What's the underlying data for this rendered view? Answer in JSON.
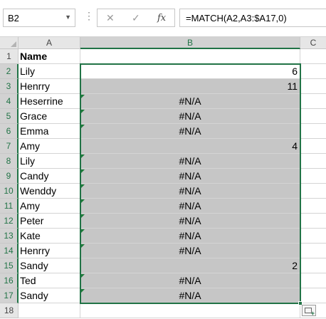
{
  "formula_bar": {
    "name_box": "B2",
    "cancel_symbol": "✕",
    "enter_symbol": "✓",
    "fx_label": "fx",
    "formula": "=MATCH(A2,A3:$A17,0)"
  },
  "columns": {
    "a": "A",
    "b": "B",
    "c": "C"
  },
  "rows": [
    {
      "num": "1",
      "a": "Name",
      "b": ""
    },
    {
      "num": "2",
      "a": "Lily",
      "b": "6"
    },
    {
      "num": "3",
      "a": "Henrry",
      "b": "11"
    },
    {
      "num": "4",
      "a": "Heserrine",
      "b": "#N/A"
    },
    {
      "num": "5",
      "a": "Grace",
      "b": "#N/A"
    },
    {
      "num": "6",
      "a": "Emma",
      "b": "#N/A"
    },
    {
      "num": "7",
      "a": "Amy",
      "b": "4"
    },
    {
      "num": "8",
      "a": "Lily",
      "b": "#N/A"
    },
    {
      "num": "9",
      "a": "Candy",
      "b": "#N/A"
    },
    {
      "num": "10",
      "a": "Wenddy",
      "b": "#N/A"
    },
    {
      "num": "11",
      "a": "Amy",
      "b": "#N/A"
    },
    {
      "num": "12",
      "a": "Peter",
      "b": "#N/A"
    },
    {
      "num": "13",
      "a": "Kate",
      "b": "#N/A"
    },
    {
      "num": "14",
      "a": "Henrry",
      "b": "#N/A"
    },
    {
      "num": "15",
      "a": "Sandy",
      "b": "2"
    },
    {
      "num": "16",
      "a": "Ted",
      "b": "#N/A"
    },
    {
      "num": "17",
      "a": "Sandy",
      "b": "#N/A"
    },
    {
      "num": "18",
      "a": "",
      "b": ""
    }
  ],
  "colors": {
    "selection": "#217346",
    "shade": "#c6c6c6",
    "error_triangle": "#1e7b3a"
  }
}
